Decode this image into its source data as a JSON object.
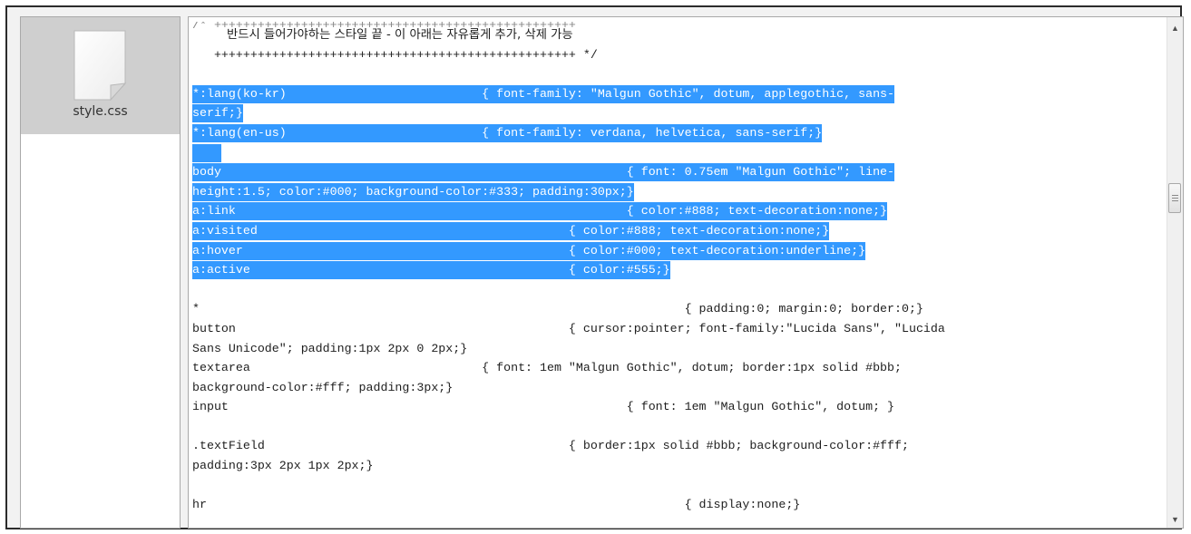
{
  "file_list": {
    "items": [
      {
        "name": "style.css",
        "icon": "document-icon",
        "selected": true
      }
    ]
  },
  "editor": {
    "scroll": {
      "position": 0.33
    },
    "lines": [
      {
        "text": "/* ++++++++++++++++++++++++++++++++++++++++++++++++++",
        "highlight": false,
        "kind": "top"
      },
      {
        "text": "         반드시 들어가야하는 스타일 끝 - 이 아래는 자유롭게 추가, 삭제 가능",
        "highlight": false,
        "kind": "ko"
      },
      {
        "text": "   ++++++++++++++++++++++++++++++++++++++++++++++++++ */",
        "highlight": false
      },
      {
        "text": "",
        "highlight": false
      },
      {
        "text": "*:lang(ko-kr)                           { font-family: \"Malgun Gothic\", dotum, applegothic, sans-",
        "highlight": true
      },
      {
        "text": "serif;}",
        "highlight": true
      },
      {
        "text": "*:lang(en-us)                           { font-family: verdana, helvetica, sans-serif;}",
        "highlight": true
      },
      {
        "text": "    ",
        "highlight": true
      },
      {
        "text": "body                                                        { font: 0.75em \"Malgun Gothic\"; line-",
        "highlight": true
      },
      {
        "text": "height:1.5; color:#000; background-color:#333; padding:30px;}",
        "highlight": true
      },
      {
        "text": "a:link                                                      { color:#888; text-decoration:none;}",
        "highlight": true
      },
      {
        "text": "a:visited                                           { color:#888; text-decoration:none;}",
        "highlight": true
      },
      {
        "text": "a:hover                                             { color:#000; text-decoration:underline;}",
        "highlight": true
      },
      {
        "text": "a:active                                            { color:#555;}",
        "highlight": true
      },
      {
        "text": "",
        "highlight": false
      },
      {
        "text": "*                                                                   { padding:0; margin:0; border:0;}",
        "highlight": false
      },
      {
        "text": "button                                              { cursor:pointer; font-family:\"Lucida Sans\", \"Lucida",
        "highlight": false
      },
      {
        "text": "Sans Unicode\"; padding:1px 2px 0 2px;}",
        "highlight": false
      },
      {
        "text": "textarea                                { font: 1em \"Malgun Gothic\", dotum; border:1px solid #bbb;",
        "highlight": false
      },
      {
        "text": "background-color:#fff; padding:3px;}",
        "highlight": false
      },
      {
        "text": "input                                                       { font: 1em \"Malgun Gothic\", dotum; }",
        "highlight": false
      },
      {
        "text": "",
        "highlight": false
      },
      {
        "text": ".textField                                          { border:1px solid #bbb; background-color:#fff;",
        "highlight": false
      },
      {
        "text": "padding:3px 2px 1px 2px;}",
        "highlight": false
      },
      {
        "text": "",
        "highlight": false
      },
      {
        "text": "hr                                                                  { display:none;}",
        "highlight": false
      }
    ]
  },
  "colors": {
    "selection": "#3399ff",
    "selected_file_bg": "#cfcfcf"
  }
}
